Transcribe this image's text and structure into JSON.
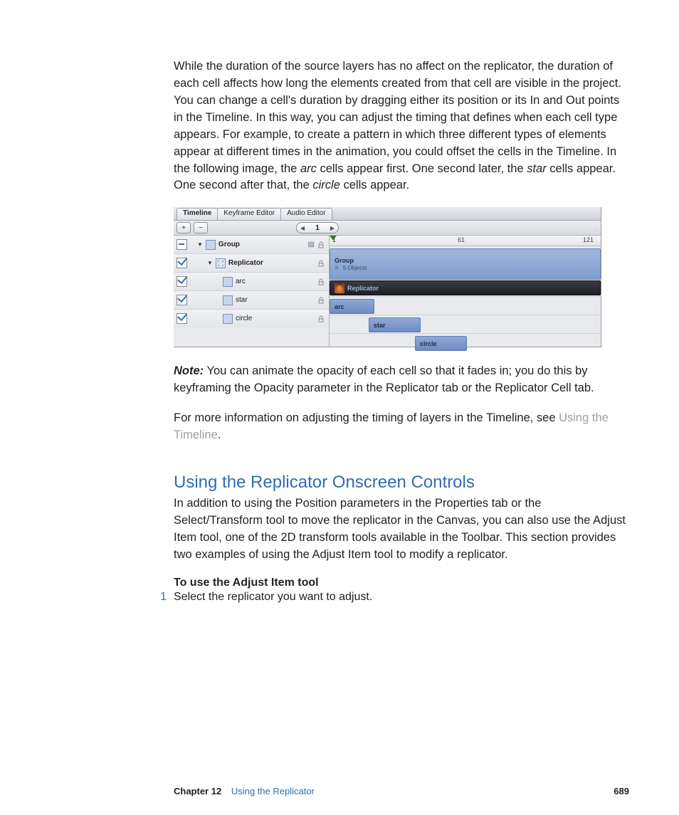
{
  "para1_a": "While the duration of the source layers has no affect on the replicator, the duration of each cell affects how long the elements created from that cell are visible in the project. You can change a cell's duration by dragging either its position or its In and Out points in the Timeline. In this way, you can adjust the timing that defines when each cell type appears. For example, to create a pattern in which three different types of elements appear at different times in the animation, you could offset the cells in the Timeline. In the following image, the ",
  "para1_arc": "arc",
  "para1_b": " cells appear first. One second later, the ",
  "para1_star": "star",
  "para1_c": " cells appear. One second after that, the ",
  "para1_circle": "circle",
  "para1_d": " cells appear.",
  "figure": {
    "tabs": [
      "Timeline",
      "Keyframe Editor",
      "Audio Editor"
    ],
    "plus": "+",
    "minus": "−",
    "spinner_value": "1",
    "rows": {
      "group": "Group",
      "replicator": "Replicator",
      "arc": "arc",
      "star": "star",
      "circle": "circle"
    },
    "ruler": {
      "t1": "1",
      "t61": "61",
      "t121": "121"
    },
    "group_bar_title": "Group",
    "group_bar_sub": "5 Objects",
    "rep_bar": "Replicator",
    "arc_bar": "arc",
    "star_bar": "star",
    "circle_bar": "circle"
  },
  "note_label": "Note:",
  "note_text": "  You can animate the opacity of each cell so that it fades in; you do this by keyframing the Opacity parameter in the Replicator tab or the Replicator Cell tab.",
  "para3_a": "For more information on adjusting the timing of layers in the Timeline, see ",
  "para3_link": "Using the Timeline",
  "para3_b": ".",
  "heading": "Using the Replicator Onscreen Controls",
  "heading_para": "In addition to using the Position parameters in the Properties tab or the Select/Transform tool to move the replicator in the Canvas, you can also use the Adjust Item tool, one of the 2D transform tools available in the Toolbar. This section provides two examples of using the Adjust Item tool to modify a replicator.",
  "sub_bold": "To use the Adjust Item tool",
  "step1_num": "1",
  "step1_text": "Select the replicator you want to adjust.",
  "footer": {
    "chapter": "Chapter 12",
    "title": "Using the Replicator",
    "page": "689"
  }
}
